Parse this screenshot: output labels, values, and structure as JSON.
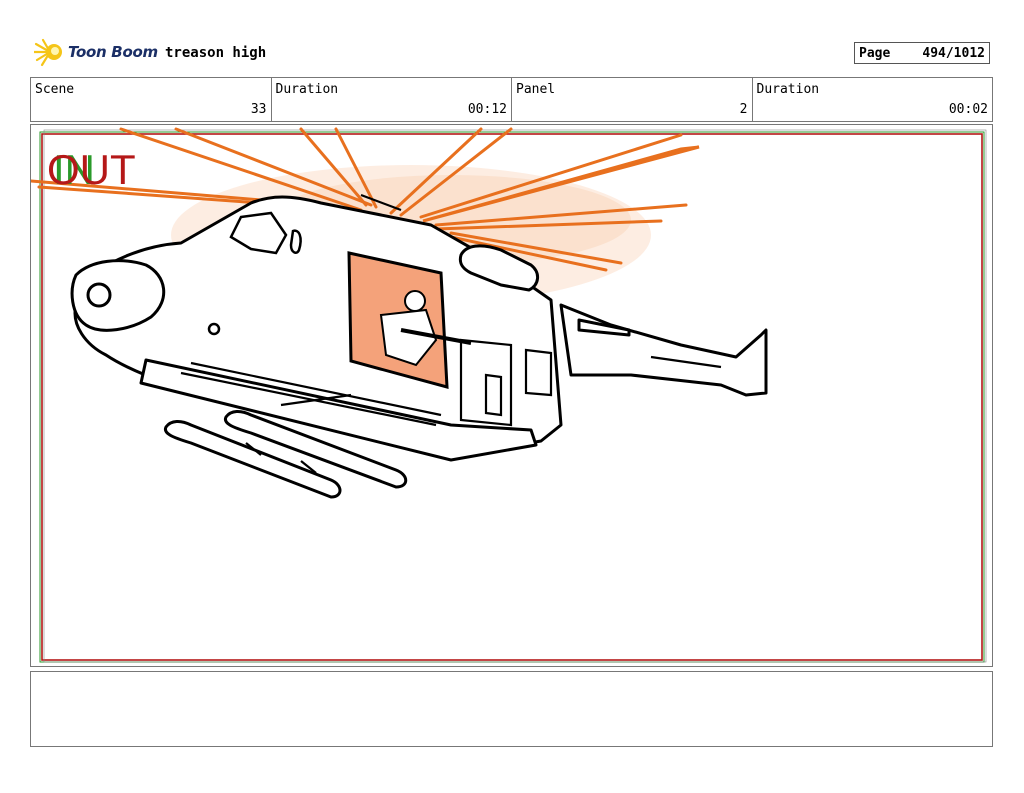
{
  "header": {
    "logo_text": "Toon Boom",
    "project_title": "treason high",
    "page_label": "Page",
    "page_value": "494/1012"
  },
  "info": {
    "scene_label": "Scene",
    "scene_value": "33",
    "duration1_label": "Duration",
    "duration1_value": "00:12",
    "panel_label": "Panel",
    "panel_value": "2",
    "duration2_label": "Duration",
    "duration2_value": "00:02"
  },
  "panel": {
    "in_marker": "IN",
    "out_marker": "OUT",
    "drawing": "helicopter-sketch",
    "colors": {
      "in": "#2a9a2a",
      "out": "#b51818",
      "rotor": "#e8701e",
      "window_fill": "#f4a27a",
      "logo_flare": "#f5c518",
      "logo_text": "#1b2f66"
    }
  },
  "notes": {
    "text": ""
  }
}
